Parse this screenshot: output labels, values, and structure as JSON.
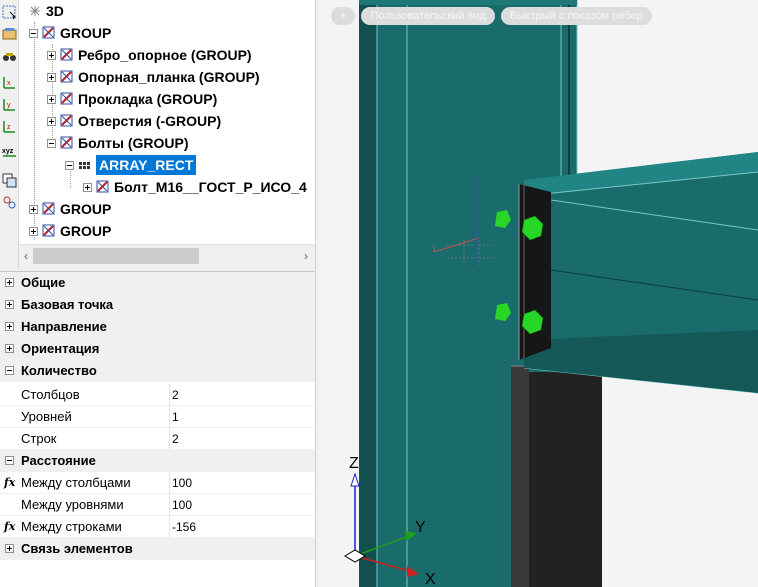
{
  "tree": {
    "root_label": "3D",
    "nodes": [
      {
        "label": "GROUP"
      },
      {
        "label": "Ребро_опорное (GROUP)"
      },
      {
        "label": "Опорная_планка (GROUP)"
      },
      {
        "label": "Прокладка (GROUP)"
      },
      {
        "label": "Отверстия (-GROUP)"
      },
      {
        "label": "Болты (GROUP)"
      },
      {
        "label": "ARRAY_RECT"
      },
      {
        "label": "Болт_М16__ГОСТ_Р_ИСО_4"
      },
      {
        "label": "GROUP"
      },
      {
        "label": "GROUP"
      }
    ]
  },
  "properties": {
    "cat_general": "Общие",
    "cat_base_point": "Базовая точка",
    "cat_direction": "Направление",
    "cat_orientation": "Ориентация",
    "cat_quantity": "Количество",
    "columns_label": "Столбцов",
    "columns_value": "2",
    "levels_label": "Уровней",
    "levels_value": "1",
    "rows_label": "Строк",
    "rows_value": "2",
    "cat_distance": "Расстояние",
    "between_columns_label": "Между столбцами",
    "between_columns_value": "100",
    "between_levels_label": "Между уровнями",
    "between_levels_value": "100",
    "between_rows_label": "Между строками",
    "between_rows_value": "-156",
    "cat_links": "Связь элементов"
  },
  "viewport": {
    "btn_plus": "+",
    "btn_view": "Пользовательский вид",
    "btn_style": "Быстрый с показом рёбер",
    "axis_z": "Z",
    "axis_y": "Y",
    "axis_x": "X"
  },
  "colors": {
    "steel": "#1a6b6b",
    "bolt": "#22dd22",
    "plate": "#1e1e1e",
    "selection": "#0078d7"
  }
}
